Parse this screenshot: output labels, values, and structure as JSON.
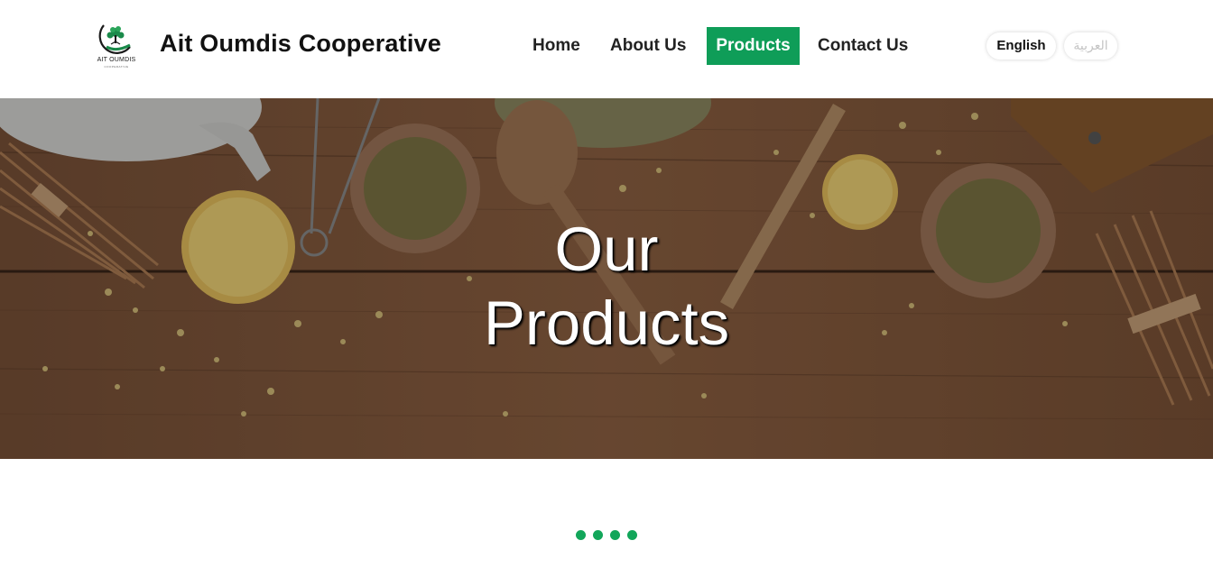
{
  "header": {
    "logo": {
      "text": "AIT OUMDIS",
      "subtext": "COOPERATIVE",
      "icon": "tree-leaf-logo-icon",
      "color": "#1a8a4a"
    },
    "brand_name": "Ait Oumdis Cooperative"
  },
  "nav": {
    "items": [
      {
        "label": "Home",
        "active": false
      },
      {
        "label": "About Us",
        "active": false
      },
      {
        "label": "Products",
        "active": true
      },
      {
        "label": "Contact Us",
        "active": false
      }
    ],
    "active_color": "#0f9d58"
  },
  "language": {
    "options": [
      {
        "label": "English",
        "selected": true
      },
      {
        "label": "العربية",
        "selected": false
      }
    ]
  },
  "hero": {
    "title_line1": "Our",
    "title_line2": "Products"
  },
  "loader": {
    "dot_count": 4,
    "color": "#12a65a"
  }
}
